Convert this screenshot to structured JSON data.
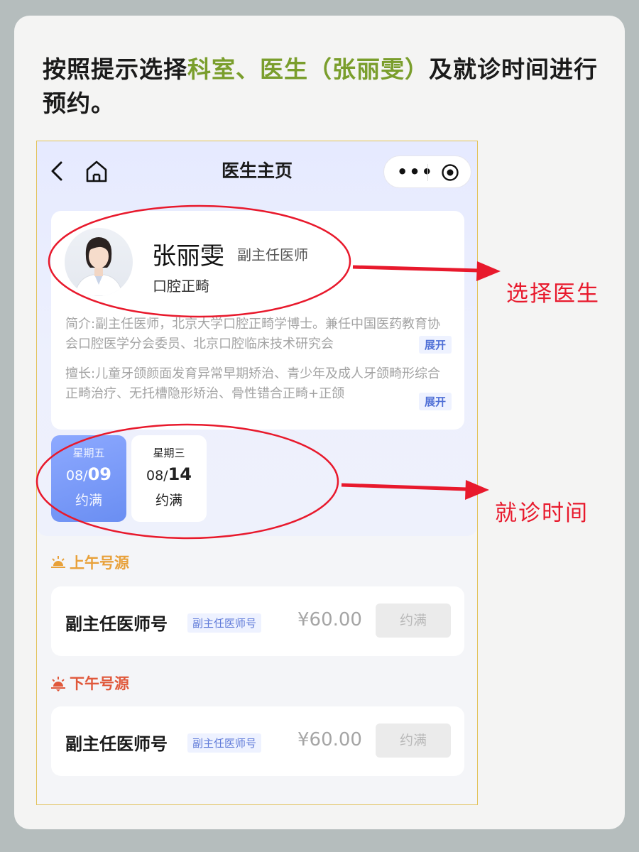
{
  "instruction": {
    "part1": "按照提示选择",
    "highlight": "科室、医生（张丽雯）",
    "part2": "及就诊时间进行预约。"
  },
  "app": {
    "nav_title": "医生主页",
    "icons": [
      "back-icon",
      "home-icon",
      "more-icon",
      "target-icon"
    ]
  },
  "doctor": {
    "name": "张丽雯",
    "title": "副主任医师",
    "department": "口腔正畸",
    "intro": "简介:副主任医师，北京大学口腔正畸学博士。兼任中国医药教育协会口腔医学分会委员、北京口腔临床技术研究会",
    "specialty": "擅长:儿童牙颌颜面发育异常早期矫治、青少年及成人牙颌畸形综合正畸治疗、无托槽隐形矫治、骨性错合正畸+正颌",
    "expand_label": "展开"
  },
  "dates": [
    {
      "weekday": "星期五",
      "month": "08/",
      "day": "09",
      "status": "约满",
      "selected": true
    },
    {
      "weekday": "星期三",
      "month": "08/",
      "day": "14",
      "status": "约满",
      "selected": false
    }
  ],
  "sessions": {
    "am": {
      "label": "上午号源",
      "slot": {
        "name": "副主任医师号",
        "tag": "副主任医师号",
        "price": "¥60.00",
        "button": "约满"
      }
    },
    "pm": {
      "label": "下午号源",
      "slot": {
        "name": "副主任医师号",
        "tag": "副主任医师号",
        "price": "¥60.00",
        "button": "约满"
      }
    }
  },
  "annotations": {
    "select_doctor": "选择医生",
    "visit_time": "就诊时间"
  },
  "colors": {
    "highlight_green": "#7a9e2c",
    "annotation_red": "#e8192c",
    "selected_date_blue": "#6a8ef2",
    "am_orange": "#e8a13a",
    "pm_red": "#e0583b"
  }
}
